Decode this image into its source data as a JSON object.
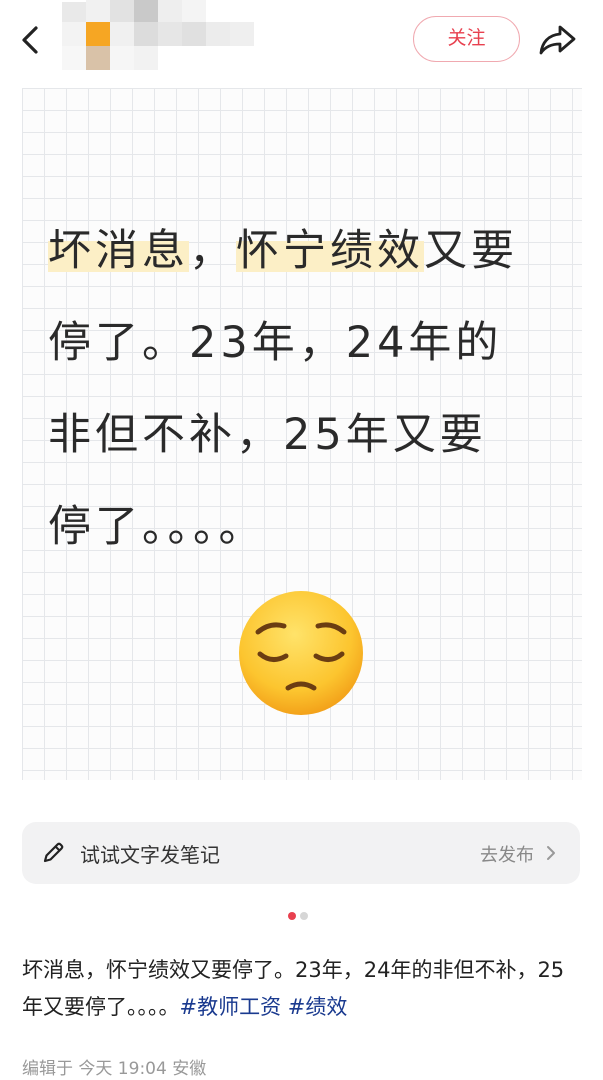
{
  "header": {
    "follow_label": "关注"
  },
  "note": {
    "line1_hl1": "坏消息",
    "line1_comma": "，",
    "line1_hl2": "怀宁绩效",
    "line1_rest": "又要",
    "line2": "停了。23年，24年的",
    "line3": "非但不补，25年又要",
    "line4": "停了。。。。",
    "emoji": "pensive-face"
  },
  "composer": {
    "label": "试试文字发笔记",
    "publish": "去发布"
  },
  "pager": {
    "total": 2,
    "active": 1
  },
  "caption": {
    "text": "坏消息，怀宁绩效又要停了。23年，24年的非但不补，25年又要停了。。。。",
    "tag1": "#教师工资",
    "tag2": "#绩效"
  },
  "meta": {
    "label": "编辑于 今天 19:04 安徽"
  },
  "colors": {
    "accent": "#e8404f",
    "tag": "#1a3a8f",
    "highlight": "#fcefc6"
  }
}
